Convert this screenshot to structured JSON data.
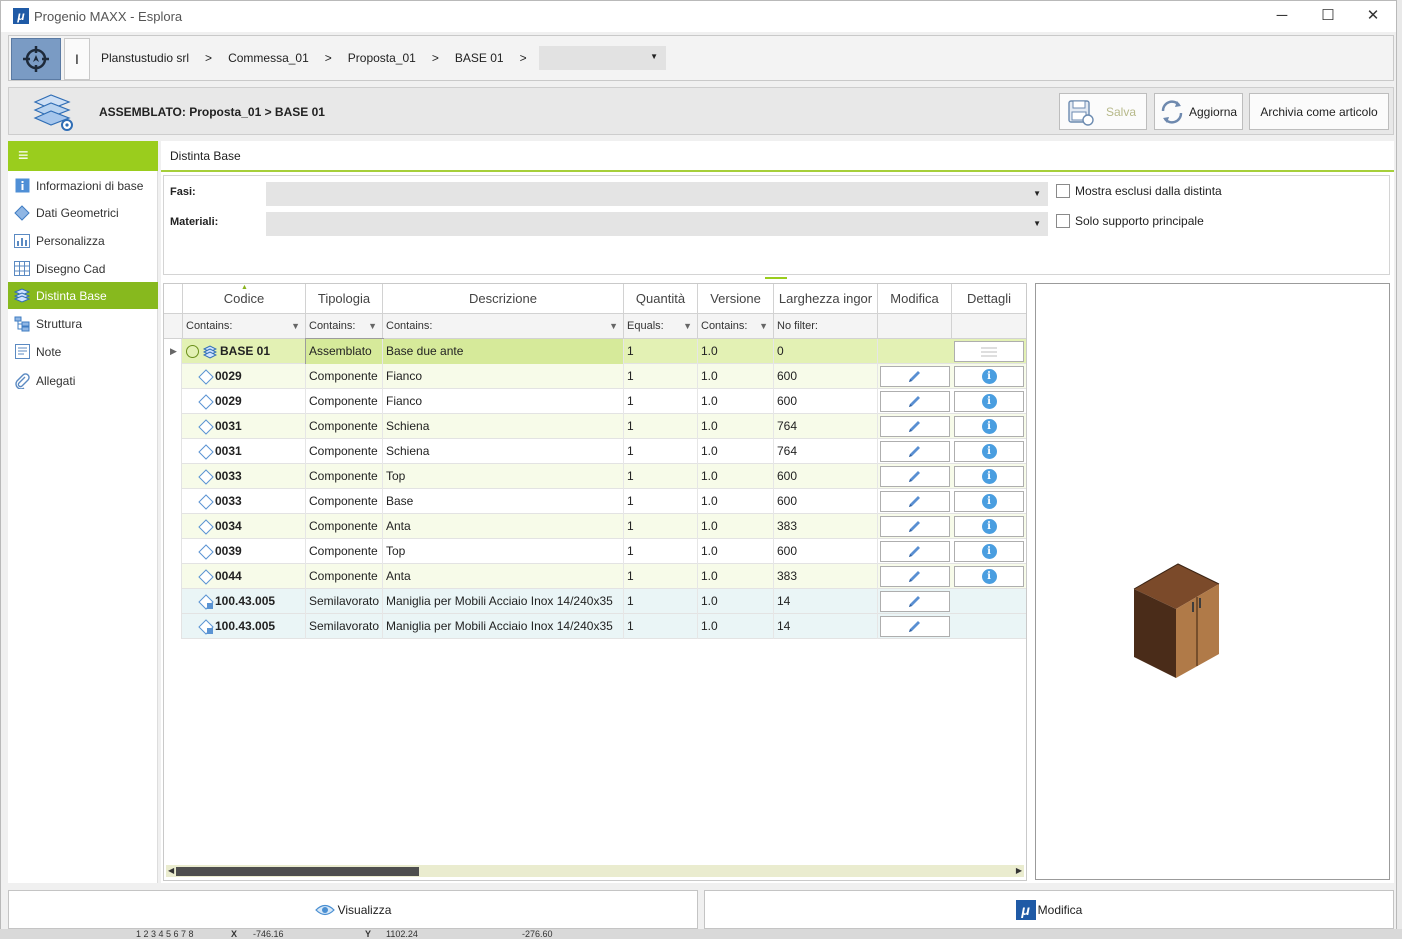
{
  "window": {
    "title": "Progenio MAXX - Esplora",
    "logo_text": "μ",
    "minimize": "─",
    "maximize": "☐",
    "close": "✕"
  },
  "breadcrumb": {
    "cursor_glyph": "I",
    "items": [
      "Planstustudio srl",
      "Commessa_01",
      "Proposta_01",
      "BASE 01"
    ],
    "separator": ">",
    "select_value": ""
  },
  "header": {
    "title": "ASSEMBLATO: Proposta_01 > BASE 01",
    "save_label": "Salva",
    "refresh_label": "Aggiorna",
    "archive_label": "Archivia come articolo"
  },
  "sidebar": {
    "menu_glyph": "≡",
    "items": [
      {
        "label": "Informazioni di base",
        "icon": "info-square-icon"
      },
      {
        "label": "Dati Geometrici",
        "icon": "diamond-icon"
      },
      {
        "label": "Personalizza",
        "icon": "chart-icon"
      },
      {
        "label": "Disegno Cad",
        "icon": "grid-icon"
      },
      {
        "label": "Distinta Base",
        "icon": "layers-icon"
      },
      {
        "label": "Struttura",
        "icon": "tree-icon"
      },
      {
        "label": "Note",
        "icon": "note-icon"
      },
      {
        "label": "Allegati",
        "icon": "paperclip-icon"
      }
    ],
    "active_index": 4
  },
  "tab": {
    "title": "Distinta Base"
  },
  "filters": {
    "fasi_label": "Fasi:",
    "fasi_value": "",
    "materiali_label": "Materiali:",
    "materiali_value": "",
    "show_excluded_label": "Mostra esclusi dalla distinta",
    "show_excluded_checked": false,
    "main_support_label": "Solo supporto principale",
    "main_support_checked": false
  },
  "grid": {
    "columns": [
      "Codice",
      "Tipologia",
      "Descrizione",
      "Quantità",
      "Versione",
      "Larghezza ingor",
      "Modifica",
      "Dettagli"
    ],
    "filter_row": [
      "Contains:",
      "Contains:",
      "Contains:",
      "Equals:",
      "Contains:",
      "No filter:",
      "",
      ""
    ],
    "rows": [
      {
        "code": "BASE 01",
        "type": "Assemblato",
        "desc": "Base due ante",
        "qty": "1",
        "ver": "1.0",
        "width": "0",
        "kind": "root"
      },
      {
        "code": "0029",
        "type": "Componente",
        "desc": "Fianco",
        "qty": "1",
        "ver": "1.0",
        "width": "600",
        "kind": "comp"
      },
      {
        "code": "0029",
        "type": "Componente",
        "desc": "Fianco",
        "qty": "1",
        "ver": "1.0",
        "width": "600",
        "kind": "comp"
      },
      {
        "code": "0031",
        "type": "Componente",
        "desc": "Schiena",
        "qty": "1",
        "ver": "1.0",
        "width": "764",
        "kind": "comp"
      },
      {
        "code": "0031",
        "type": "Componente",
        "desc": "Schiena",
        "qty": "1",
        "ver": "1.0",
        "width": "764",
        "kind": "comp"
      },
      {
        "code": "0033",
        "type": "Componente",
        "desc": "Top",
        "qty": "1",
        "ver": "1.0",
        "width": "600",
        "kind": "comp"
      },
      {
        "code": "0033",
        "type": "Componente",
        "desc": "Base",
        "qty": "1",
        "ver": "1.0",
        "width": "600",
        "kind": "comp"
      },
      {
        "code": "0034",
        "type": "Componente",
        "desc": "Anta",
        "qty": "1",
        "ver": "1.0",
        "width": "383",
        "kind": "comp"
      },
      {
        "code": "0039",
        "type": "Componente",
        "desc": "Top",
        "qty": "1",
        "ver": "1.0",
        "width": "600",
        "kind": "comp"
      },
      {
        "code": "0044",
        "type": "Componente",
        "desc": "Anta",
        "qty": "1",
        "ver": "1.0",
        "width": "383",
        "kind": "comp"
      },
      {
        "code": "100.43.005",
        "type": "Semilavorato",
        "desc": "Maniglia per Mobili Acciaio Inox 14/240x35",
        "qty": "1",
        "ver": "1.0",
        "width": "14",
        "kind": "semi"
      },
      {
        "code": "100.43.005",
        "type": "Semilavorato",
        "desc": "Maniglia per Mobili Acciaio Inox 14/240x35",
        "qty": "1",
        "ver": "1.0",
        "width": "14",
        "kind": "semi"
      }
    ]
  },
  "footer": {
    "view_label": "Visualizza",
    "edit_label": "Modifica"
  },
  "statusbar": {
    "pages": "1 2 3 4 5 6 7 8",
    "x_label": "X",
    "x_value": "-746.16",
    "y_label": "Y",
    "y_value": "1102.24",
    "z_value": "-276.60"
  },
  "colors": {
    "accent_green": "#9acd1d",
    "active_green": "#87b91e",
    "root_row": "#e3f1b4",
    "info_blue": "#4a9ee0"
  }
}
